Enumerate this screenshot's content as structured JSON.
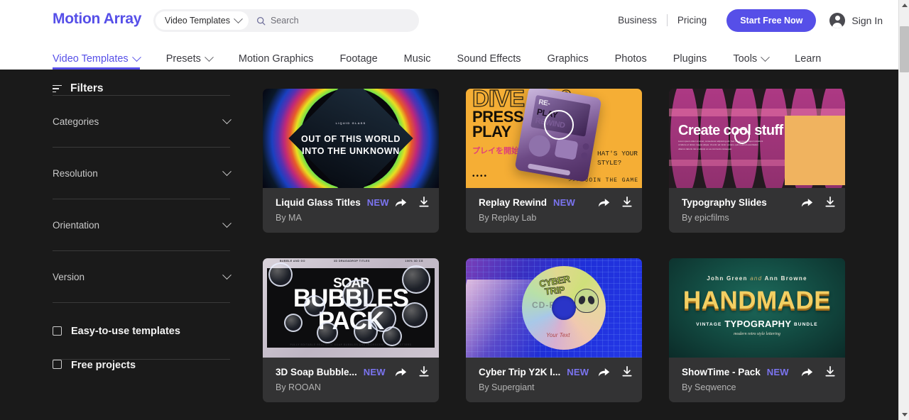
{
  "header": {
    "brand": "Motion Array",
    "search": {
      "scope": "Video Templates",
      "placeholder": "Search",
      "scope_icon": "chevron-down-icon",
      "search_icon": "search-icon"
    },
    "links": [
      {
        "label": "Business"
      },
      {
        "label": "Pricing"
      }
    ],
    "cta": "Start Free Now",
    "signin": "Sign In",
    "accent_color": "#564fe8"
  },
  "nav": {
    "items": [
      {
        "label": "Video Templates",
        "has_chevron": true,
        "active": true
      },
      {
        "label": "Presets",
        "has_chevron": true,
        "active": false
      },
      {
        "label": "Motion Graphics",
        "has_chevron": false,
        "active": false
      },
      {
        "label": "Footage",
        "has_chevron": false,
        "active": false
      },
      {
        "label": "Music",
        "has_chevron": false,
        "active": false
      },
      {
        "label": "Sound Effects",
        "has_chevron": false,
        "active": false
      },
      {
        "label": "Graphics",
        "has_chevron": false,
        "active": false
      },
      {
        "label": "Photos",
        "has_chevron": false,
        "active": false
      },
      {
        "label": "Plugins",
        "has_chevron": false,
        "active": false
      },
      {
        "label": "Tools",
        "has_chevron": true,
        "active": false
      },
      {
        "label": "Learn",
        "has_chevron": false,
        "active": false
      }
    ]
  },
  "sidebar": {
    "title": "Filters",
    "title_icon": "filter-lines-icon",
    "groups": [
      {
        "label": "Categories",
        "icon": "chevron-down-icon"
      },
      {
        "label": "Resolution",
        "icon": "chevron-down-icon"
      },
      {
        "label": "Orientation",
        "icon": "chevron-down-icon"
      },
      {
        "label": "Version",
        "icon": "chevron-down-icon"
      }
    ],
    "checkboxes": [
      {
        "label": "Easy-to-use templates",
        "checked": false
      },
      {
        "label": "Free projects",
        "checked": false
      }
    ]
  },
  "cards": [
    {
      "title": "Liquid Glass Titles",
      "badge": "NEW",
      "author": "By MA",
      "share_icon": "share-icon",
      "download_icon": "download-icon",
      "art": {
        "kind": "liquid-glass",
        "tiny": "LIQUID GLASS",
        "line1": "OUT OF THIS WORLD",
        "line2": "INTO THE UNKNOWN"
      }
    },
    {
      "title": "Replay Rewind",
      "badge": "NEW",
      "author": "By Replay Lab",
      "share_icon": "share-icon",
      "download_icon": "download-icon",
      "art": {
        "kind": "replay-rewind",
        "outline": "DIVE IN &",
        "press": "PRESS\nPLAY",
        "jp": "プレイを開始",
        "dots": "••••",
        "right1": "HAT'S YOUR",
        "right2": "STYLE?",
        "join": ">>> JOIN THE GAME",
        "screen1": "RE-",
        "screen2": "PLAY",
        "screen3": "REWIND"
      }
    },
    {
      "title": "Typography Slides",
      "badge": "",
      "author": "By epicfilms",
      "share_icon": "share-icon",
      "download_icon": "download-icon",
      "art": {
        "kind": "typography-slides",
        "heading": "Create cool stuff",
        "body": "Lorem ipsum dolor sit amet, consectetur adipiscing elit. Sed do eiusmod tempor incididunt ut labore et dolore magna aliqua. Ut enim ad minim veniam, quis nostrud exercitation ullamco laboris nisi ut aliquip ex ea commodo consequat."
      }
    },
    {
      "title": "3D Soap Bubble...",
      "badge": "NEW",
      "author": "By ROOAN",
      "share_icon": "share-icon",
      "download_icon": "download-icon",
      "art": {
        "kind": "soap-bubbles",
        "line1": "SOAP",
        "line2": "BUBBLES",
        "line3": "PACK",
        "top_left": "BUBBLE AND GO",
        "top_mid": "3D DRAG&DROP TITLES",
        "top_right": "100% 3D CG",
        "bottom": "FULLY EDITABLE REALISTIC SOAP BUBBLES AND IRIDESCENT SOAPY LETTERS"
      }
    },
    {
      "title": "Cyber Trip Y2K I...",
      "badge": "NEW",
      "author": "By Supergiant",
      "share_icon": "share-icon",
      "download_icon": "download-icon",
      "art": {
        "kind": "cyber-trip",
        "line1": "CYBER",
        "line2": "TRIP",
        "cdr": "CD-R",
        "yourtext": "Your Text"
      }
    },
    {
      "title": "ShowTime - Pack",
      "badge": "NEW",
      "author": "By Seqwence",
      "share_icon": "share-icon",
      "download_icon": "download-icon",
      "art": {
        "kind": "showtime",
        "credit_left": "John Green",
        "credit_amp": "and",
        "credit_right": "Ann Browne",
        "big": "HANDMADE",
        "typo_pre": "VINTAGE",
        "typo_main": "TYPOGRAPHY",
        "typo_post": "BUNDLE",
        "script": "modern retro style lettering"
      }
    }
  ],
  "scrollbar": {
    "up_icon": "triangle-up-icon",
    "down_icon": "triangle-down-icon",
    "thumb": "scroll-thumb"
  }
}
